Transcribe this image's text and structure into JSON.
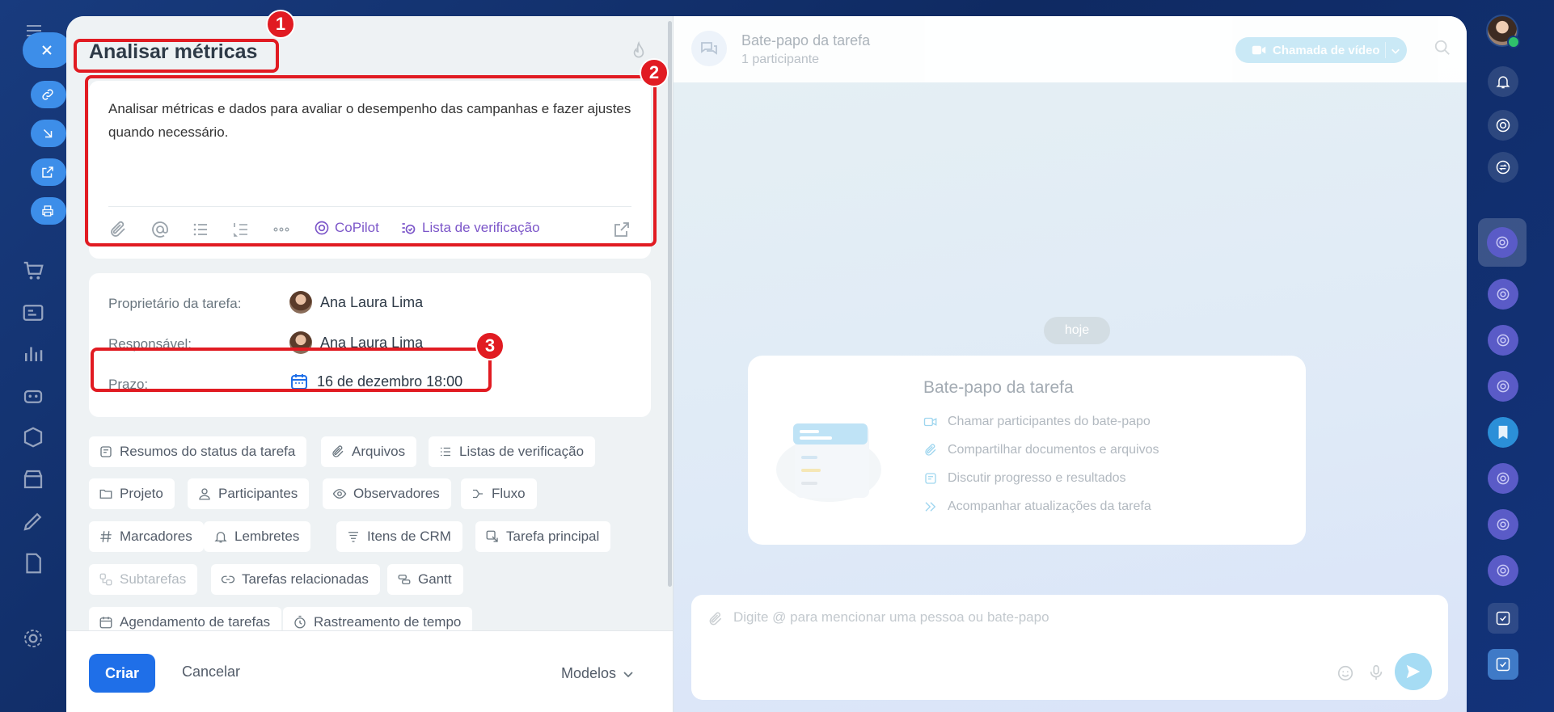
{
  "task": {
    "title": "Analisar métricas",
    "description": "Analisar métricas e dados para avaliar o desempenho das campanhas e fazer ajustes quando necessário.",
    "toolbar": {
      "copilot_label": "CoPilot",
      "checklist_label": "Lista de verificação"
    }
  },
  "fields": {
    "owner_label": "Proprietário da tarefa:",
    "owner_value": "Ana Laura Lima",
    "responsible_label": "Responsável:",
    "responsible_value": "Ana Laura Lima",
    "deadline_label": "Prazo:",
    "deadline_value": "16 de dezembro 18:00"
  },
  "chips": [
    {
      "label": "Resumos do status da tarefa",
      "icon": "status-summary-icon"
    },
    {
      "label": "Arquivos",
      "icon": "paperclip-icon"
    },
    {
      "label": "Listas de verificação",
      "icon": "checklist-icon"
    },
    {
      "label": "Projeto",
      "icon": "folder-icon"
    },
    {
      "label": "Participantes",
      "icon": "person-icon"
    },
    {
      "label": "Observadores",
      "icon": "eye-icon"
    },
    {
      "label": "Fluxo",
      "icon": "flow-icon"
    },
    {
      "label": "Marcadores",
      "icon": "hash-icon"
    },
    {
      "label": "Lembretes",
      "icon": "bell-icon"
    },
    {
      "label": "Itens de CRM",
      "icon": "crm-icon"
    },
    {
      "label": "Tarefa principal",
      "icon": "parent-task-icon"
    },
    {
      "label": "Subtarefas",
      "icon": "subtasks-icon"
    },
    {
      "label": "Tarefas relacionadas",
      "icon": "link-icon"
    },
    {
      "label": "Gantt",
      "icon": "gantt-icon"
    },
    {
      "label": "Agendamento de tarefas",
      "icon": "calendar-icon"
    },
    {
      "label": "Rastreamento de tempo",
      "icon": "timer-icon"
    }
  ],
  "footer": {
    "create_label": "Criar",
    "cancel_label": "Cancelar",
    "templates_label": "Modelos"
  },
  "chat": {
    "title": "Bate-papo da tarefa",
    "subtitle": "1 participante",
    "video_call_label": "Chamada de vídeo",
    "today_label": "hoje",
    "welcome_title": "Bate-papo da tarefa",
    "welcome_items": [
      "Chamar participantes do bate-papo",
      "Compartilhar documentos e arquivos",
      "Discutir progresso e resultados",
      "Acompanhar atualizações da tarefa"
    ],
    "composer_placeholder": "Digite @ para mencionar uma pessoa ou bate-papo"
  },
  "annotations": [
    "1",
    "2",
    "3"
  ],
  "colors": {
    "accent": "#1f6fe8",
    "annotation": "#e11b22",
    "copilot": "#7c56c9"
  }
}
